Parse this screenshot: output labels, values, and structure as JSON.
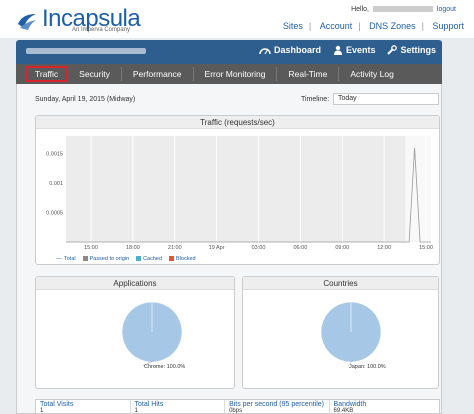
{
  "brand": {
    "name": "Incapsula",
    "tagline": "An Imperva Company"
  },
  "header": {
    "hello": "Hello,",
    "logout": "logout",
    "links": [
      "Sites",
      "Account",
      "DNS Zones",
      "Support"
    ]
  },
  "navbar": {
    "dashboard": "Dashboard",
    "events": "Events",
    "settings": "Settings"
  },
  "tabs": [
    "Traffic",
    "Security",
    "Performance",
    "Error Monitoring",
    "Real-Time",
    "Activity Log"
  ],
  "page": {
    "date": "Sunday, April 19, 2015 (Midway)",
    "timeline_label": "Timeline:",
    "timeline_value": "Today"
  },
  "colors": {
    "brand_blue": "#1f5fa8",
    "navbar": "#2d5e8e",
    "tab_active_border": "#d9232d",
    "pie": "#a7c7e7"
  },
  "traffic_chart": {
    "title": "Traffic (requests/sec)"
  },
  "chart_data": [
    {
      "type": "line",
      "title": "Traffic (requests/sec)",
      "x_ticks": [
        "15:00",
        "18:00",
        "21:00",
        "19 Apr",
        "03:00",
        "06:00",
        "09:00",
        "12:00",
        "15:00"
      ],
      "y_ticks": [
        "0.0015",
        "0.001",
        "0.0005"
      ],
      "ylim": [
        0,
        0.0018
      ],
      "legend": [
        "Total",
        "Passed to origin",
        "Cached",
        "Blocked"
      ],
      "legend_colors": [
        "#aac4dd",
        "#888888",
        "#4fb0c6",
        "#e4572e"
      ],
      "series": [
        {
          "name": "Total",
          "x": [
            0,
            0.94,
            0.955,
            0.97,
            1.0
          ],
          "values": [
            0,
            0,
            0.0016,
            0,
            0
          ]
        }
      ]
    },
    {
      "type": "pie",
      "title": "Applications",
      "categories": [
        "Chrome"
      ],
      "values": [
        100.0
      ],
      "labels": [
        "Chrome: 100.0%"
      ]
    },
    {
      "type": "pie",
      "title": "Countries",
      "categories": [
        "Japan"
      ],
      "values": [
        100.0
      ],
      "labels": [
        "Japan: 100.0%"
      ]
    }
  ],
  "stats": [
    {
      "label": "Total Visits",
      "value": "1"
    },
    {
      "label": "Total Hits",
      "value": "1"
    },
    {
      "label": "Bits per second (95 percentile)",
      "value": "0bps"
    },
    {
      "label": "Bandwidth",
      "value": "69.4KB"
    }
  ]
}
